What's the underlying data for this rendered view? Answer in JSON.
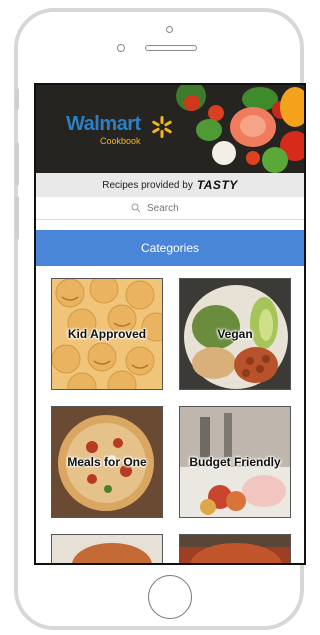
{
  "banner": {
    "logo_word": "Walmart",
    "logo_sub": "Cookbook"
  },
  "provided": {
    "prefix": "Recipes provided by",
    "brand": "TASTY"
  },
  "search": {
    "placeholder": "Search"
  },
  "categories": {
    "title": "Categories",
    "items": [
      {
        "label": "Kid Approved"
      },
      {
        "label": "Vegan"
      },
      {
        "label": "Meals for One"
      },
      {
        "label": "Budget Friendly"
      }
    ]
  },
  "colors": {
    "accent": "#4a86d8",
    "walmart_blue": "#2d7fc4",
    "walmart_yellow": "#f2b522"
  }
}
